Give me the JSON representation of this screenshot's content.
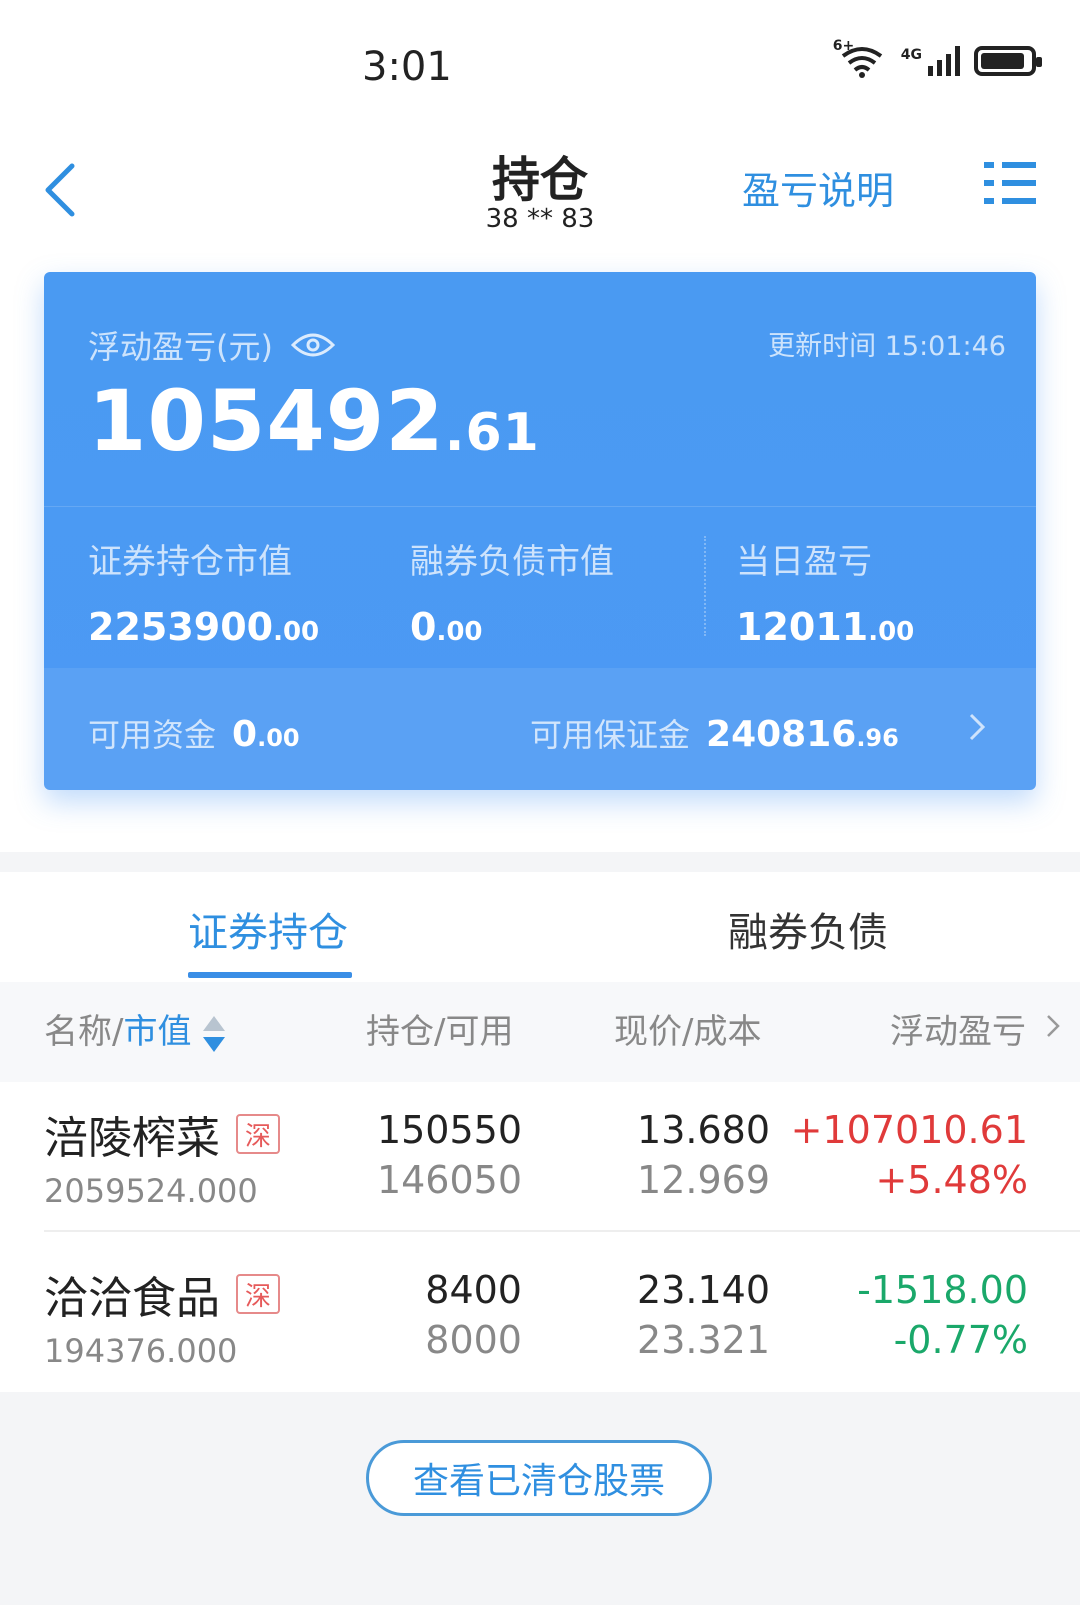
{
  "status_bar": {
    "time": "3:01",
    "wifi_label": "6+",
    "network_label": "4G",
    "battery_level": 0.9
  },
  "header": {
    "title": "持仓",
    "account": "38 ** 83",
    "explain_link": "盈亏说明"
  },
  "summary": {
    "float_label": "浮动盈亏(元)",
    "update_time": "更新时间 15:01:46",
    "float_value_int": "105492",
    "float_value_dec": ".61",
    "metrics": [
      {
        "label": "证券持仓市值",
        "int": "2253900",
        "dec": ".00"
      },
      {
        "label": "融券负债市值",
        "int": "0",
        "dec": ".00"
      },
      {
        "label": "当日盈亏",
        "int": "12011",
        "dec": ".00"
      }
    ],
    "available_cash_label": "可用资金",
    "available_cash_int": "0",
    "available_cash_dec": ".00",
    "available_margin_label": "可用保证金",
    "available_margin_int": "240816",
    "available_margin_dec": ".96"
  },
  "tabs": [
    {
      "label": "证券持仓",
      "active": true
    },
    {
      "label": "融券负债",
      "active": false
    }
  ],
  "table": {
    "headers": {
      "name_prefix": "名称/",
      "name_highlight": "市值",
      "position": "持仓/可用",
      "price": "现价/成本",
      "pnl": "浮动盈亏"
    },
    "rows": [
      {
        "name": "涪陵榨菜",
        "market": "深",
        "market_value": "2059524.000",
        "holding": "150550",
        "available": "146050",
        "price": "13.680",
        "cost": "12.969",
        "pnl": "+107010.61",
        "pnl_pct": "+5.48%",
        "pnl_color": "#e03a3a"
      },
      {
        "name": "洽洽食品",
        "market": "深",
        "market_value": "194376.000",
        "holding": "8400",
        "available": "8000",
        "price": "23.140",
        "cost": "23.321",
        "pnl": "-1518.00",
        "pnl_pct": "-0.77%",
        "pnl_color": "#1aa86a"
      }
    ]
  },
  "cleared_button": "查看已清仓股票",
  "colors": {
    "accent": "#2f8fe0",
    "card": "#4c99f4",
    "gain": "#e03a3a",
    "loss": "#1aa86a"
  }
}
